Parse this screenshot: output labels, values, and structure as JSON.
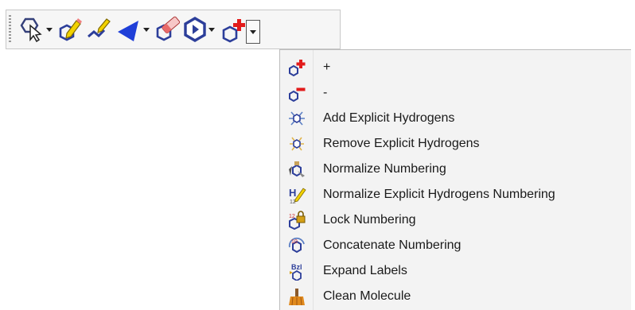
{
  "toolbar": {
    "tools": [
      {
        "icon": "select-arrow-icon"
      },
      {
        "icon": "pencil-ring-icon"
      },
      {
        "icon": "chain-icon"
      },
      {
        "icon": "wedge-bond-icon"
      },
      {
        "icon": "eraser-ring-icon"
      },
      {
        "icon": "hexagon-ring-icon"
      },
      {
        "icon": "charge-plus-icon"
      }
    ]
  },
  "menu": {
    "items": [
      {
        "label": "+",
        "icon": "charge-plus-icon"
      },
      {
        "label": "-",
        "icon": "charge-minus-icon"
      },
      {
        "label": "Add Explicit Hydrogens",
        "icon": "add-hydrogens-icon"
      },
      {
        "label": "Remove Explicit Hydrogens",
        "icon": "remove-hydrogens-icon"
      },
      {
        "label": "Normalize Numbering",
        "icon": "normalize-numbering-icon"
      },
      {
        "label": "Normalize Explicit Hydrogens Numbering",
        "icon": "normalize-hydrogens-numbering-icon"
      },
      {
        "label": "Lock Numbering",
        "icon": "lock-numbering-icon"
      },
      {
        "label": "Concatenate Numbering",
        "icon": "concatenate-numbering-icon"
      },
      {
        "label": "Expand Labels",
        "icon": "expand-labels-icon"
      },
      {
        "label": "Clean Molecule",
        "icon": "clean-molecule-icon"
      }
    ]
  },
  "colors": {
    "toolbar_bg": "#f6f6f6",
    "menu_bg": "#f3f3f3",
    "accent_red": "#e21b1b",
    "accent_blue": "#1f3fd8",
    "ring_blue": "#2c3e9a",
    "yellow": "#f2d200"
  }
}
